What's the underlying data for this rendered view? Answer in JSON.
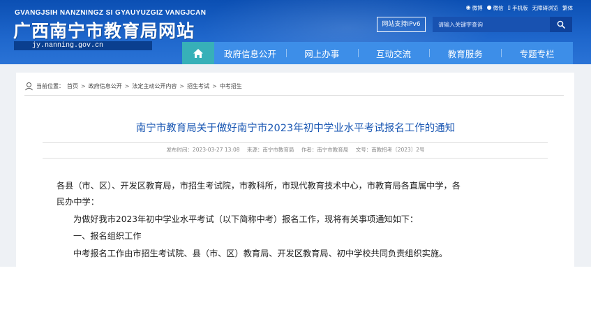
{
  "header": {
    "pinyin": "GVANGJSIH NANZNINGZ SI GYAUYUZGIZ VANGJCAN",
    "title": "广西南宁市教育局网站",
    "domain": "jy.nanning.gov.cn",
    "ipv6_label": "网站支持IPv6",
    "search_placeholder": "请输入关键字查询",
    "top_links": [
      {
        "label": "微博",
        "icon": "weibo-icon"
      },
      {
        "label": "微信",
        "icon": "wechat-icon"
      },
      {
        "label": "手机版",
        "icon": "mobile-icon"
      },
      {
        "label": "无障碍浏览",
        "icon": ""
      },
      {
        "label": "繁体",
        "icon": ""
      }
    ]
  },
  "nav": {
    "home_icon": "home-icon",
    "items": [
      "政府信息公开",
      "网上办事",
      "互动交流",
      "教育服务",
      "专题专栏"
    ]
  },
  "breadcrumb": {
    "prefix": "当前位置：",
    "items": [
      "首页",
      "政府信息公开",
      "法定主动公开内容",
      "招生考试",
      "中考招生"
    ],
    "separator": ">"
  },
  "article": {
    "title": "南宁市教育局关于做好南宁市2023年初中学业水平考试报名工作的通知",
    "meta": {
      "published": "发布时间：2023-03-27 13:08",
      "source": "来源：南宁市教育局",
      "author": "作者：南宁市教育局",
      "doc_no": "文号：南教招考〔2023〕2号"
    },
    "paragraphs": [
      "各县（市、区）、开发区教育局，市招生考试院，市教科所，市现代教育技术中心，市教育局各直属中学，各",
      "民办中学：",
      "为做好我市2023年初中学业水平考试（以下简称中考）报名工作，现将有关事项通知如下：",
      "一、报名组织工作",
      "中考报名工作由市招生考试院、县（市、区）教育局、开发区教育局、初中学校共同负责组织实施。"
    ]
  },
  "colors": {
    "header_blue": "#1f67cc",
    "nav_blue": "#3d8ee8",
    "nav_home_teal": "#37b0b8",
    "title_blue": "#1a57b3"
  }
}
